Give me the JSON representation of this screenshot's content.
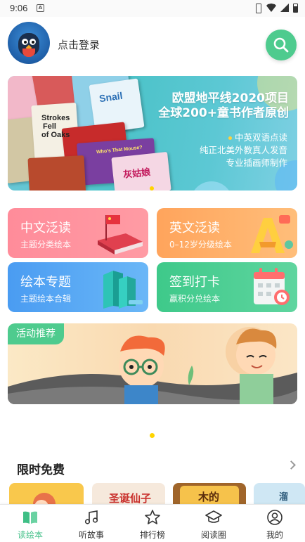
{
  "status_bar": {
    "time": "9:06",
    "notification_icon": "a-icon"
  },
  "header": {
    "login_text": "点击登录",
    "search_icon": "search-icon",
    "accent": "#4ecb8e"
  },
  "banner": {
    "headline_line1": "欧盟地平线2020项目",
    "headline_line2": "全球200+童书作者原创",
    "features": [
      "中英双语点读",
      "纯正北美外教真人发音",
      "专业插画师制作"
    ],
    "book_titles": [
      "Strokes",
      "Fell",
      "of Oaks",
      "Who's That Mouse?",
      "灰姑娘",
      "Snail"
    ],
    "page_indicator": "1"
  },
  "categories": [
    {
      "title": "中文泛读",
      "subtitle": "主题分类绘本",
      "color": "#ff8c9a"
    },
    {
      "title": "英文泛读",
      "subtitle": "0–12岁分级绘本",
      "color": "#ffa45c"
    },
    {
      "title": "绘本专题",
      "subtitle": "主题绘本合辑",
      "color": "#4a9cf2"
    },
    {
      "title": "签到打卡",
      "subtitle": "赢积分兑绘本",
      "color": "#3ec98a"
    }
  ],
  "activity": {
    "tag": "活动推荐"
  },
  "free_section": {
    "title": "限时免费",
    "thumbs": [
      "",
      "圣诞仙子",
      "木的",
      "溜"
    ]
  },
  "bottom_nav": {
    "items": [
      {
        "label": "读绘本",
        "icon": "book-icon",
        "active": true
      },
      {
        "label": "听故事",
        "icon": "music-note-icon",
        "active": false
      },
      {
        "label": "排行榜",
        "icon": "star-icon",
        "active": false
      },
      {
        "label": "阅读圈",
        "icon": "graduation-cap-icon",
        "active": false
      },
      {
        "label": "我的",
        "icon": "user-icon",
        "active": false
      }
    ],
    "active_color": "#3fbf86"
  }
}
